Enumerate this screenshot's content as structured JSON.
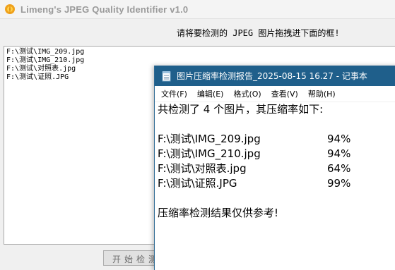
{
  "app": {
    "title": "Limeng's JPEG Quality Identifier v1.0",
    "instruction": "请将要检测的 JPEG 图片拖拽进下面的框!",
    "files": [
      "F:\\测试\\IMG_209.jpg",
      "F:\\测试\\IMG_210.jpg",
      "F:\\测试\\对照表.jpg",
      "F:\\测试\\证照.JPG"
    ],
    "start_button_label": "开始检测"
  },
  "notepad": {
    "title": "图片压缩率检测报告_2025-08-15 16.27 - 记事本",
    "menu": [
      "文件(F)",
      "编辑(E)",
      "格式(O)",
      "查看(V)",
      "帮助(H)"
    ],
    "summary": "共检测了 4 个图片，其压缩率如下:",
    "rows": [
      {
        "path": "F:\\测试\\IMG_209.jpg",
        "rate": "94%"
      },
      {
        "path": "F:\\测试\\IMG_210.jpg",
        "rate": "94%"
      },
      {
        "path": "F:\\测试\\对照表.jpg",
        "rate": "64%"
      },
      {
        "path": "F:\\测试\\证照.JPG",
        "rate": "99%"
      }
    ],
    "footer": "压缩率检测结果仅供参考!"
  },
  "colors": {
    "notepad_titlebar": "#1f5f8b",
    "app_title_text": "#9a9a9a"
  }
}
